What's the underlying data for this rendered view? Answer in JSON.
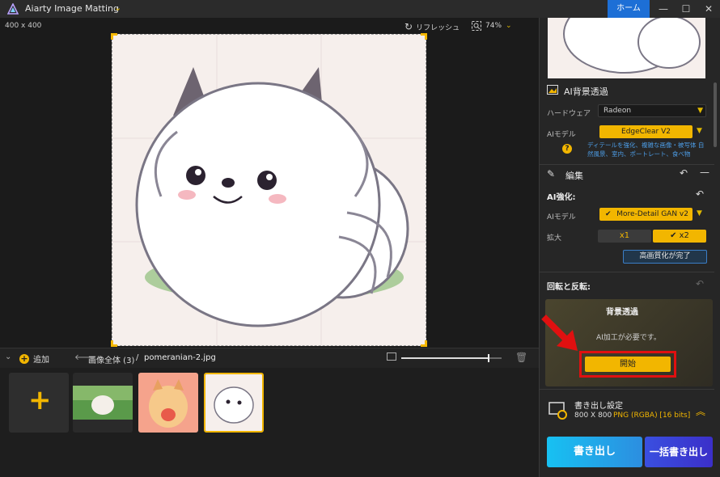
{
  "app": {
    "title": "Aiarty Image Matting",
    "home_label": "ホーム"
  },
  "canvas": {
    "dimensions": "400 x 400",
    "refresh_label": "リフレッシュ",
    "zoom": "74%"
  },
  "strip": {
    "add_label": "追加",
    "breadcrumb_all": "画像全体 (3)",
    "breadcrumb_sep": "/",
    "breadcrumb_file": "pomeranian-2.jpg",
    "slider_level": 0.87
  },
  "panel": {
    "bg_section": {
      "title": "AI背景透過",
      "hardware_label": "ハードウェア",
      "hardware_value": "Radeon",
      "model_label": "AIモデル",
      "model_value": "EdgeClear  V2",
      "note": "ディテールを強化、複雑な画像・被写体 自然風景、室内、ポートレート、食べ物"
    },
    "edit_section": {
      "title": "編集",
      "enhance_title": "AI強化:",
      "model_label": "AIモデル",
      "model_value": "More-Detail GAN v2",
      "scale_label": "拡大",
      "scale_x1": "x1",
      "scale_x2": "x2",
      "upscale_done": "高画質化が完了",
      "rotate_title": "回転と反転:"
    },
    "transparency": {
      "title": "背景透過",
      "message": "AI加工が必要です。",
      "start_label": "開始"
    },
    "export": {
      "title": "書き出し設定",
      "size": "800 X 800",
      "format": "PNG (RGBA) [16 bits]",
      "export_label": "書き出し",
      "batch_label": "一括書き出し"
    }
  },
  "colors": {
    "accent": "#f2b600",
    "home": "#1d6fd6",
    "export_btn": "#22a6e8",
    "batch_btn": "#3b45d8",
    "highlight": "#e01010"
  }
}
